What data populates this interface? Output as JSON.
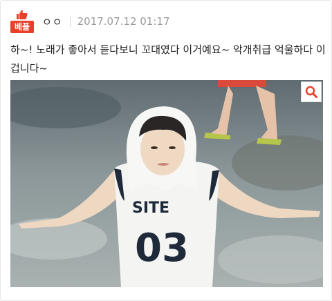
{
  "post": {
    "badge_label": "베플",
    "author": "ㅇㅇ",
    "date": "2017.07.12 01:17",
    "text": "하~! 노래가 좋아서 듣다보니 꼬대였다 이거예요~ 악개취급 억울하다 이겁니다~"
  },
  "icons": {
    "badge": "thumbs-up-icon",
    "zoom": "magnifier-icon"
  },
  "colors": {
    "accent": "#e8402a",
    "date": "#9a9a9a"
  }
}
